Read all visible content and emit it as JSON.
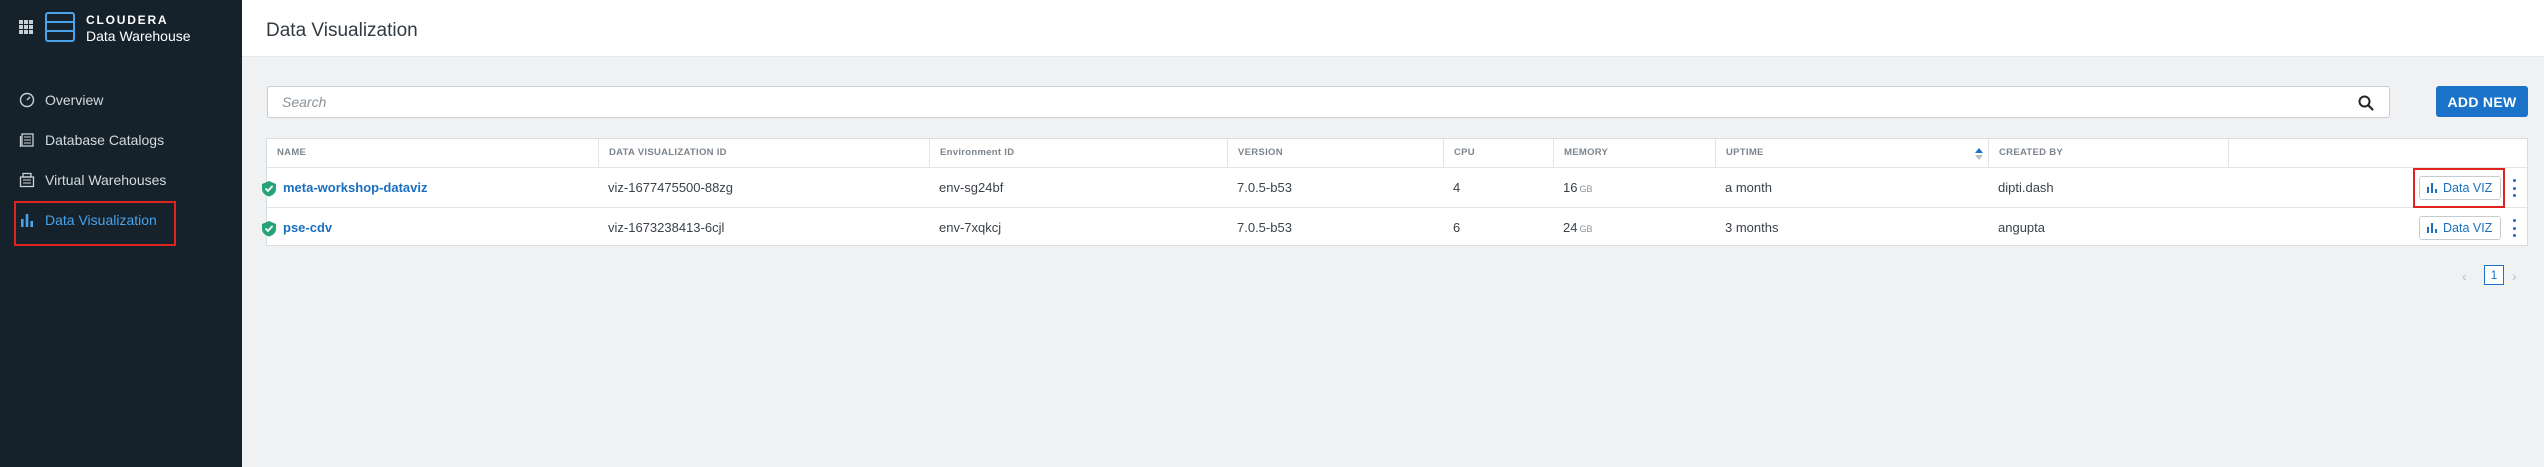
{
  "brand": {
    "line1": "CLOUDERA",
    "line2": "Data Warehouse"
  },
  "sidebar": {
    "items": [
      {
        "label": "Overview",
        "icon": "speedometer-icon"
      },
      {
        "label": "Database Catalogs",
        "icon": "database-catalog-icon"
      },
      {
        "label": "Virtual Warehouses",
        "icon": "warehouse-icon"
      },
      {
        "label": "Data Visualization",
        "icon": "bar-chart-icon",
        "active": true
      }
    ]
  },
  "header": {
    "title": "Data Visualization"
  },
  "search": {
    "placeholder": "Search",
    "value": ""
  },
  "toolbar": {
    "add_new_label": "ADD NEW"
  },
  "table": {
    "columns": [
      "NAME",
      "DATA VISUALIZATION ID",
      "Environment ID",
      "VERSION",
      "CPU",
      "MEMORY",
      "UPTIME",
      "CREATED BY"
    ],
    "rows": [
      {
        "name": "meta-workshop-dataviz",
        "id": "viz-1677475500-88zg",
        "env": "env-sg24bf",
        "version": "7.0.5-b53",
        "cpu": "4",
        "memory": "16",
        "memory_unit": "GB",
        "uptime": "a month",
        "created_by": "dipti.dash",
        "action": "Data VIZ"
      },
      {
        "name": "pse-cdv",
        "id": "viz-1673238413-6cjl",
        "env": "env-7xqkcj",
        "version": "7.0.5-b53",
        "cpu": "6",
        "memory": "24",
        "memory_unit": "GB",
        "uptime": "3 months",
        "created_by": "angupta",
        "action": "Data VIZ"
      }
    ]
  },
  "pagination": {
    "prev": "‹",
    "current": "1",
    "next": "›"
  },
  "colors": {
    "accent": "#1a73c8",
    "sidebar_bg": "#15222b",
    "status_ok": "#27a37a",
    "highlight": "#e1231f"
  }
}
